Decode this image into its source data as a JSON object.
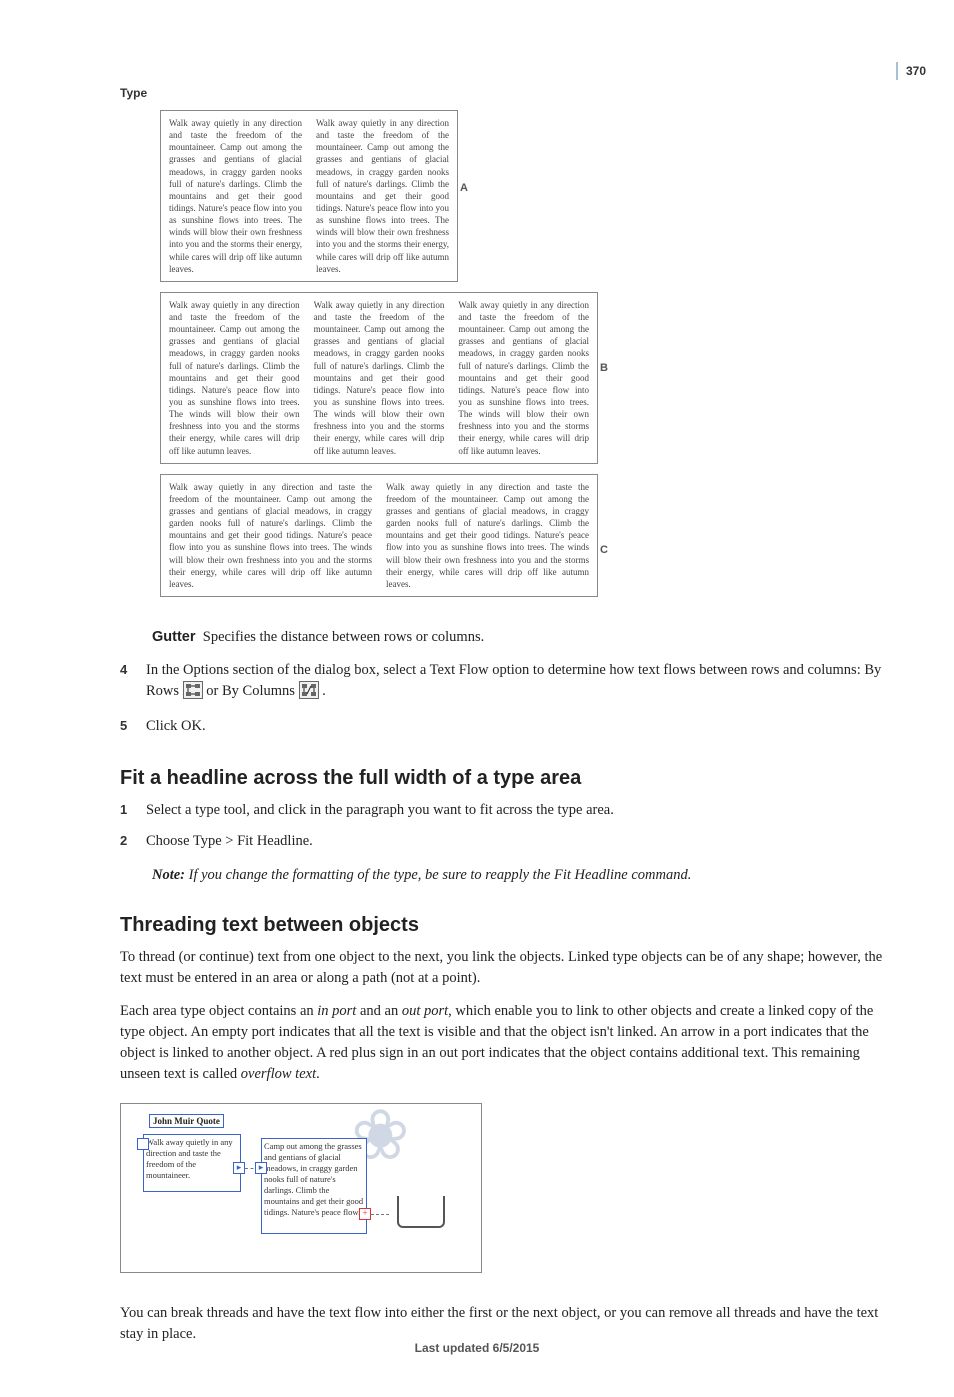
{
  "meta": {
    "side_label": "Type",
    "page_number": "370",
    "footer": "Last updated 6/5/2015"
  },
  "diagram": {
    "filler": "Walk away quietly in any direction and taste the freedom of the mountaineer. Camp out among the grasses and gentians of glacial meadows, in craggy garden nooks full of nature's darlings. Climb the mountains and get their good tidings. Nature's peace flow into you as sunshine flows into trees. The winds will blow their own freshness into you and the storms their energy, while cares will drip off like autumn leaves.",
    "label_a": "A",
    "label_b": "B",
    "label_c": "C"
  },
  "gutter": {
    "term": "Gutter",
    "desc": "Specifies the distance between rows or columns."
  },
  "step4": {
    "num": "4",
    "text_a": "In the Options section of the dialog box, select a Text Flow option to determine how text flows between rows and columns: By Rows ",
    "text_b": " or By Columns ",
    "text_c": "."
  },
  "step5": {
    "num": "5",
    "text": "Click OK."
  },
  "sec1": {
    "title": "Fit a headline across the full width of a type area",
    "s1_num": "1",
    "s1": "Select a type tool, and click in the paragraph you want to fit across the type area.",
    "s2_num": "2",
    "s2": "Choose Type > Fit Headline.",
    "note_label": "Note:",
    "note_body": " If you change the formatting of the type, be sure to reapply the Fit Headline command."
  },
  "sec2": {
    "title": "Threading text between objects",
    "p1": "To thread (or continue) text from one object to the next, you link the objects. Linked type objects can be of any shape; however, the text must be entered in an area or along a path (not at a point).",
    "p2a": "Each area type object contains an ",
    "p2_in": "in port",
    "p2b": " and an ",
    "p2_out": "out port",
    "p2c": ", which enable you to link to other objects and create a linked copy of the type object. An empty port indicates that all the text is visible and that the object isn't linked. An arrow in a port indicates that the object is linked to another object. A red plus sign in an out port indicates that the object contains additional text. This remaining unseen text is called ",
    "p2_overflow": "overflow text",
    "p2d": ".",
    "p3": "You can break threads and have the text flow into either the first or the next object, or you can remove all threads and have the text stay in place."
  },
  "figure": {
    "label": "John Muir Quote",
    "box1": "Walk away quietly in any direction and taste the freedom of the mountaineer.",
    "box2": "Camp out among the grasses and gentians of glacial meadows, in craggy garden nooks full of nature's darlings. Climb the mountains and get their good tidings. Nature's peace flows"
  }
}
